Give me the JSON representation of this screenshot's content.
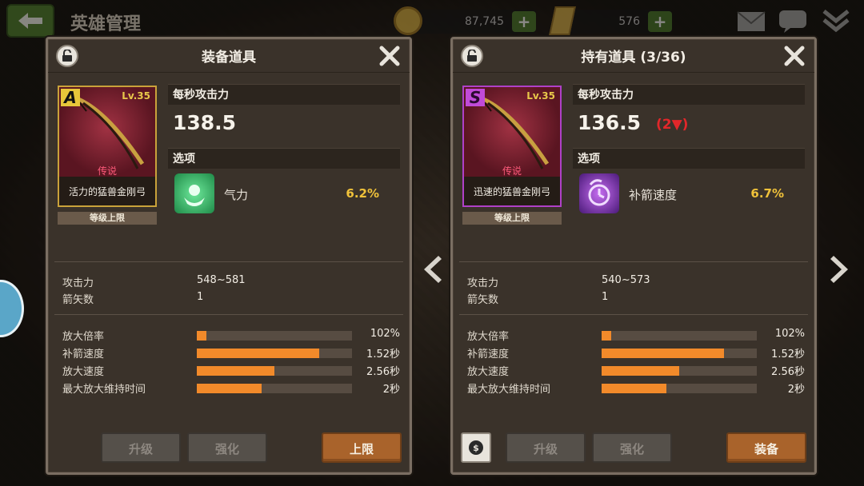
{
  "topbar": {
    "title": "英雄管理",
    "gold": "87,745",
    "gems": "576",
    "plus_label": "+"
  },
  "equipped_panel": {
    "title": "装备道具",
    "item": {
      "grade": "A",
      "level": "Lv.35",
      "rarity": "传说",
      "name": "活力的猛兽金刚弓",
      "limit_tag": "等级上限"
    },
    "dps_header": "每秒攻击力",
    "dps_value": "138.5",
    "option_header": "选项",
    "option": {
      "name": "气力",
      "value": "6.2%",
      "icon": "strength-icon",
      "color": "#3fcf6a"
    },
    "stats": [
      {
        "label": "攻击力",
        "value": "548~581"
      },
      {
        "label": "箭矢数",
        "value": "1"
      }
    ],
    "bars": [
      {
        "label": "放大倍率",
        "fill": 0.06,
        "value": "102%"
      },
      {
        "label": "补箭速度",
        "fill": 0.79,
        "value": "1.52秒"
      },
      {
        "label": "放大速度",
        "fill": 0.5,
        "value": "2.56秒"
      },
      {
        "label": "最大放大维持时间",
        "fill": 0.42,
        "value": "2秒"
      }
    ],
    "buttons": {
      "upgrade": "升级",
      "enhance": "强化",
      "action": "上限"
    }
  },
  "owned_panel": {
    "title": "持有道具 (3/36)",
    "item": {
      "grade": "S",
      "level": "Lv.35",
      "rarity": "传说",
      "name": "迅速的猛兽金刚弓",
      "limit_tag": "等级上限"
    },
    "dps_header": "每秒攻击力",
    "dps_value": "136.5",
    "dps_diff": "(2▼)",
    "option_header": "选项",
    "option": {
      "name": "补箭速度",
      "value": "6.7%",
      "icon": "reload-speed-icon",
      "color": "#9a3ad8"
    },
    "stats": [
      {
        "label": "攻击力",
        "value": "540~573"
      },
      {
        "label": "箭矢数",
        "value": "1"
      }
    ],
    "bars": [
      {
        "label": "放大倍率",
        "fill": 0.06,
        "value": "102%"
      },
      {
        "label": "补箭速度",
        "fill": 0.79,
        "value": "1.52秒"
      },
      {
        "label": "放大速度",
        "fill": 0.5,
        "value": "2.56秒"
      },
      {
        "label": "最大放大维持时间",
        "fill": 0.42,
        "value": "2秒"
      }
    ],
    "buttons": {
      "upgrade": "升级",
      "enhance": "强化",
      "action": "装备"
    }
  },
  "colors": {
    "bar_fill": "#f28a2a",
    "accent_orange": "#a9632b",
    "option_value": "#f0c23a",
    "diff_red": "#e2272a"
  }
}
